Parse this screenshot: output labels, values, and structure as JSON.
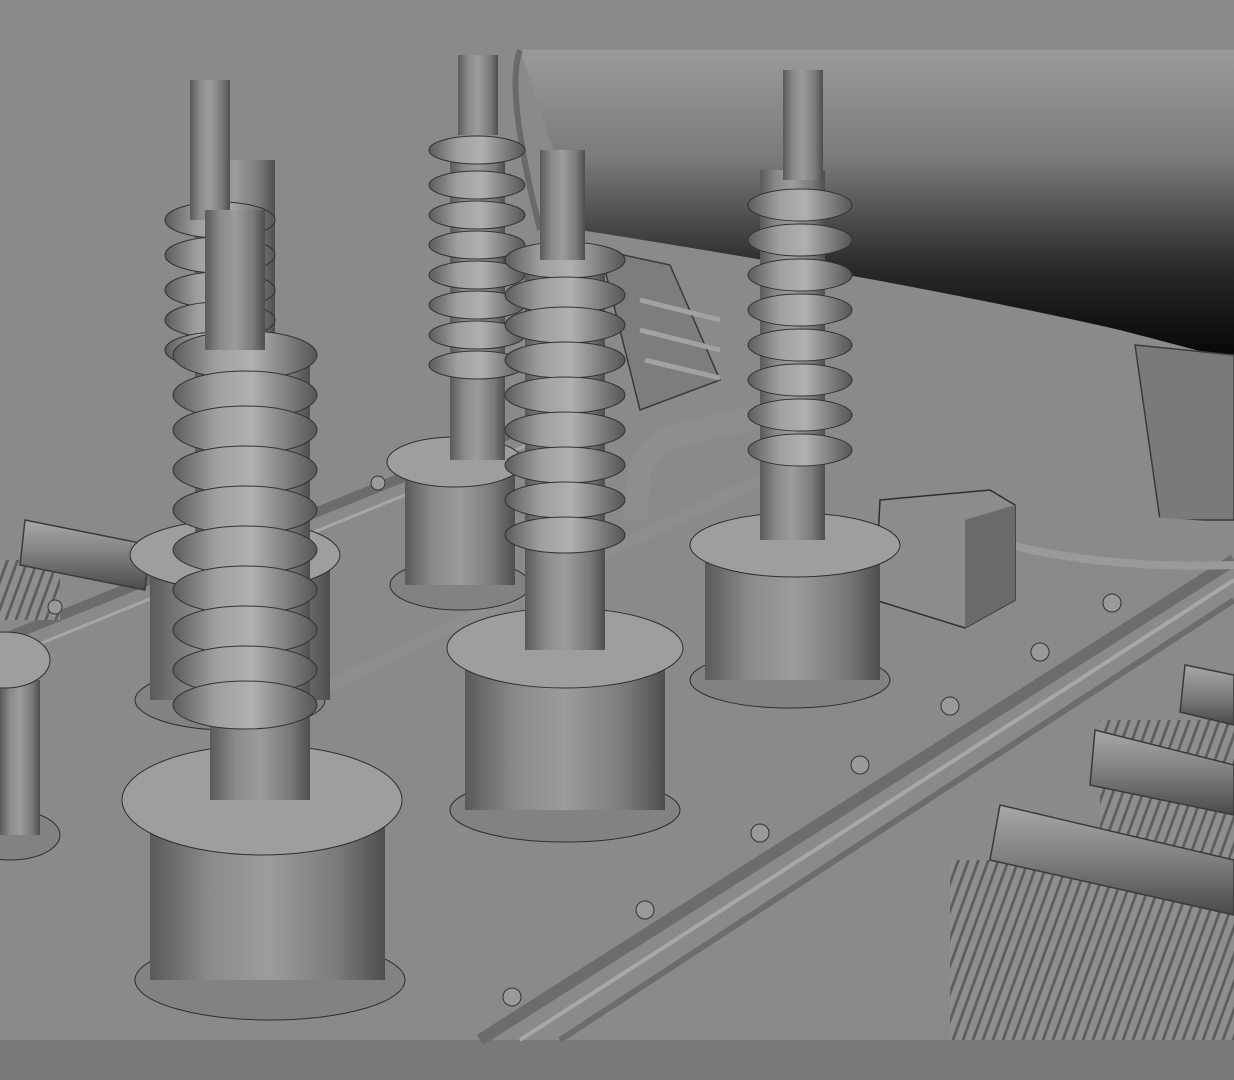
{
  "scene": {
    "description_free": true,
    "render_style": "grey-shaded-3d-viewport",
    "colors": {
      "background": "#8a8a8a",
      "surface": "#8f8f8f",
      "surface_light": "#a9a9a9",
      "surface_dark": "#5e5e5e",
      "edge": "#2e2e2e",
      "shadow": "#0a0a0a"
    },
    "objects": {
      "bushings": 5,
      "flanged_bases": 6,
      "rear_tank": "cylinder",
      "junction_box": 1,
      "radiator_pipes": 3
    }
  }
}
